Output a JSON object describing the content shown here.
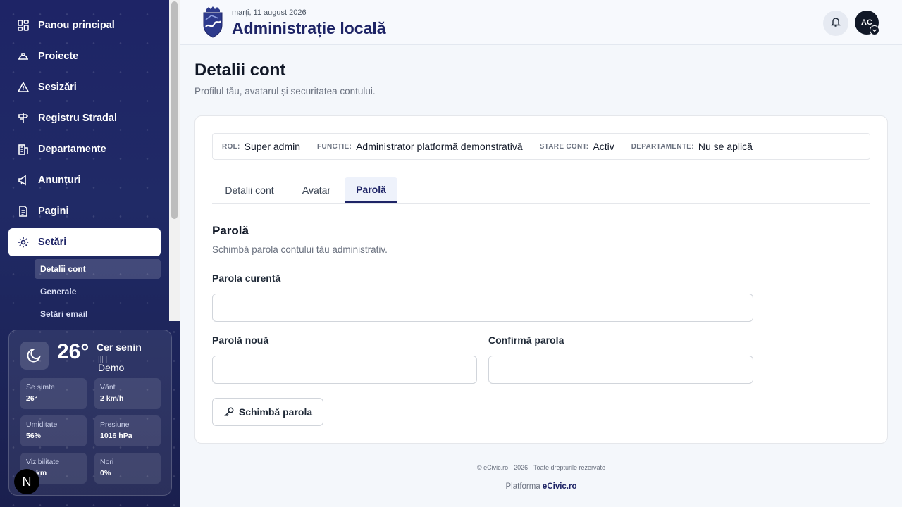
{
  "sidebar": {
    "items": [
      {
        "label": "Panou principal",
        "icon": "dashboard-icon"
      },
      {
        "label": "Proiecte",
        "icon": "helmet-icon"
      },
      {
        "label": "Sesizări",
        "icon": "warning-icon"
      },
      {
        "label": "Registru Stradal",
        "icon": "signpost-icon"
      },
      {
        "label": "Departamente",
        "icon": "building-icon"
      },
      {
        "label": "Anunțuri",
        "icon": "megaphone-icon"
      },
      {
        "label": "Pagini",
        "icon": "page-icon"
      },
      {
        "label": "Setări",
        "icon": "gear-icon",
        "active": true
      }
    ],
    "subitems": [
      {
        "label": "Detalii cont",
        "active": true
      },
      {
        "label": "Generale"
      },
      {
        "label": "Setări email"
      }
    ],
    "weather": {
      "temp": "26°",
      "desc": "Cer senin",
      "demo": "Demo",
      "bars": "|||   |",
      "tiles": [
        {
          "label": "Se simte",
          "value": "26°"
        },
        {
          "label": "Vânt",
          "value": "2 km/h"
        },
        {
          "label": "Umiditate",
          "value": "56%"
        },
        {
          "label": "Presiune",
          "value": "1016 hPa"
        },
        {
          "label": "Vizibilitate",
          "value": "km"
        },
        {
          "label": "Nori",
          "value": "0%"
        }
      ]
    },
    "badge": "N"
  },
  "header": {
    "date": "marți, 11 august 2026",
    "title": "Administrație locală",
    "avatar_initials": "AC"
  },
  "page": {
    "title": "Detalii cont",
    "subtitle": "Profilul tău, avatarul și securitatea contului."
  },
  "meta": [
    {
      "key": "ROL:",
      "value": "Super admin"
    },
    {
      "key": "FUNCȚIE:",
      "value": "Administrator platformă demonstrativă"
    },
    {
      "key": "STARE CONT:",
      "value": "Activ"
    },
    {
      "key": "DEPARTAMENTE:",
      "value": "Nu se aplică"
    }
  ],
  "tabs": [
    {
      "label": "Detalii cont"
    },
    {
      "label": "Avatar"
    },
    {
      "label": "Parolă",
      "active": true
    }
  ],
  "form": {
    "title": "Parolă",
    "subtitle": "Schimbă parola contului tău administrativ.",
    "current_label": "Parola curentă",
    "new_label": "Parolă nouă",
    "confirm_label": "Confirmă parola",
    "current_value": "",
    "new_value": "",
    "confirm_value": "",
    "button_label": "Schimbă parola"
  },
  "footer": {
    "copyright": "© eCivic.ro · 2026 · Toate drepturile rezervate",
    "platform_prefix": "Platforma",
    "platform_name": "eCivic.ro"
  },
  "colors": {
    "sidebar_bg": "#1e2466",
    "accent": "#1e2466",
    "card_bg": "#ffffff"
  }
}
